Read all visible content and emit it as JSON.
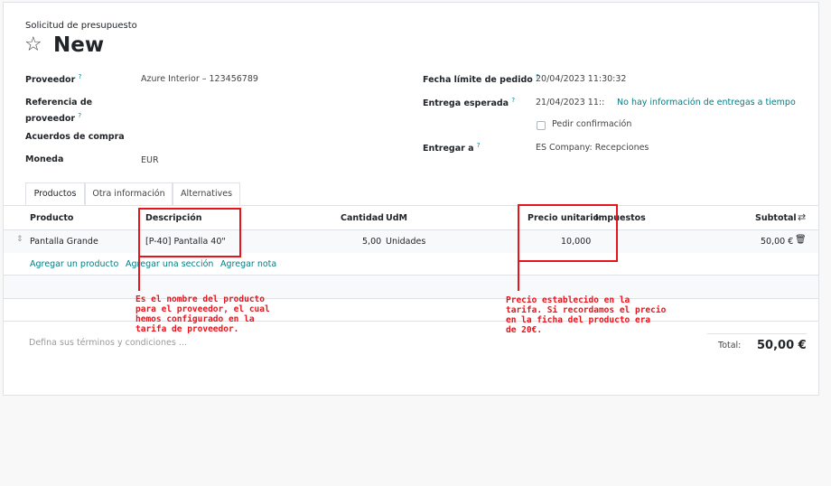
{
  "header": {
    "breadcrumb": "Solicitud de presupuesto",
    "title": "New"
  },
  "form": {
    "vendor_label": "Proveedor",
    "vendor_value": "Azure Interior – 123456789",
    "vendor_ref_label_1": "Referencia de",
    "vendor_ref_label_2": "proveedor",
    "agreement_label": "Acuerdos de compra",
    "currency_label": "Moneda",
    "currency_value": "EUR",
    "deadline_label": "Fecha límite de pedido",
    "deadline_value": "20/04/2023 11:30:32",
    "expected_label": "Entrega esperada",
    "expected_value": "21/04/2023 11::",
    "ontime_info": "No hay información de entregas a tiempo",
    "confirm_label": "Pedir confirmación",
    "deliver_label": "Entregar a",
    "deliver_value": "ES Company: Recepciones",
    "help_mark": "?"
  },
  "tabs": [
    "Productos",
    "Otra información",
    "Alternatives"
  ],
  "table": {
    "headers": {
      "product": "Producto",
      "description": "Descripción",
      "quantity": "Cantidad",
      "uom": "UdM",
      "unit_price": "Precio unitario",
      "taxes": "Impuestos",
      "subtotal": "Subtotal"
    },
    "rows": [
      {
        "product": "Pantalla Grande",
        "description": "[P-40] Pantalla 40\"",
        "quantity": "5,00",
        "uom": "Unidades",
        "unit_price": "10,000",
        "subtotal": "50,00 €"
      }
    ],
    "add_product": "Agregar un producto",
    "add_section": "Agregar una sección",
    "add_note": "Agregar nota"
  },
  "footer": {
    "terms_placeholder": "Defina sus términos y condiciones ...",
    "total_label": "Total:",
    "total_value": "50,00 €"
  },
  "annotations": {
    "description_note": "Es el nombre del producto\npara el proveedor, el cual\nhemos configurado en la\ntarifa de proveedor.",
    "price_note": "Precio establecido en la\ntarifa. Si recordamos el precio\nen la ficha del producto era\nde 20€."
  },
  "colors": {
    "accent": "#017e84",
    "annotation": "#e8141c"
  },
  "icons": {
    "star": "star-outline-icon",
    "drag": "drag-handle-icon",
    "delete": "trash-icon",
    "columns": "adjust-columns-icon"
  }
}
